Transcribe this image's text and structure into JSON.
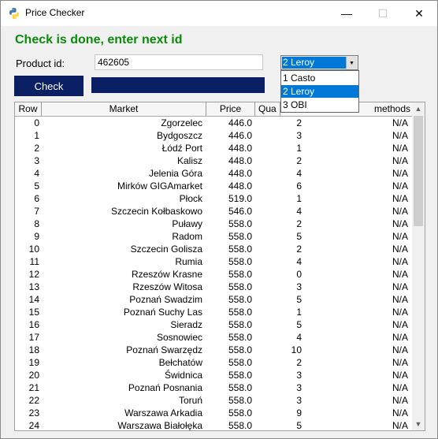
{
  "window": {
    "title": "Price Checker",
    "minimize_glyph": "—",
    "maximize_glyph": "☐",
    "close_glyph": "✕"
  },
  "status_text": "Check is done, enter next id",
  "product": {
    "label": "Product id:",
    "value": "462605"
  },
  "store_select": {
    "selected": "2 Leroy",
    "options": [
      "1 Casto",
      "2 Leroy",
      "3 OBI"
    ],
    "selected_index": 1
  },
  "check_button": "Check",
  "progress": {
    "fraction": 1.0
  },
  "table": {
    "columns": [
      "Row",
      "Market",
      "Price",
      "Quantity",
      "Payment methods"
    ],
    "column_headers_visible": {
      "row": "Row",
      "market": "Market",
      "price": "Price",
      "qty": "Qua",
      "pay": "methods"
    },
    "rows": [
      [
        "0",
        "Zgorzelec",
        "446.0",
        "2",
        "N/A"
      ],
      [
        "1",
        "Bydgoszcz",
        "446.0",
        "3",
        "N/A"
      ],
      [
        "2",
        "Łódź Port",
        "448.0",
        "1",
        "N/A"
      ],
      [
        "3",
        "Kalisz",
        "448.0",
        "2",
        "N/A"
      ],
      [
        "4",
        "Jelenia Góra",
        "448.0",
        "4",
        "N/A"
      ],
      [
        "5",
        "Mirków GIGAmarket",
        "448.0",
        "6",
        "N/A"
      ],
      [
        "6",
        "Płock",
        "519.0",
        "1",
        "N/A"
      ],
      [
        "7",
        "Szczecin Kołbaskowo",
        "546.0",
        "4",
        "N/A"
      ],
      [
        "8",
        "Puławy",
        "558.0",
        "2",
        "N/A"
      ],
      [
        "9",
        "Radom",
        "558.0",
        "5",
        "N/A"
      ],
      [
        "10",
        "Szczecin Golisza",
        "558.0",
        "2",
        "N/A"
      ],
      [
        "11",
        "Rumia",
        "558.0",
        "4",
        "N/A"
      ],
      [
        "12",
        "Rzeszów Krasne",
        "558.0",
        "0",
        "N/A"
      ],
      [
        "13",
        "Rzeszów Witosa",
        "558.0",
        "3",
        "N/A"
      ],
      [
        "14",
        "Poznań Swadzim",
        "558.0",
        "5",
        "N/A"
      ],
      [
        "15",
        "Poznań Suchy Las",
        "558.0",
        "1",
        "N/A"
      ],
      [
        "16",
        "Sieradz",
        "558.0",
        "5",
        "N/A"
      ],
      [
        "17",
        "Sosnowiec",
        "558.0",
        "4",
        "N/A"
      ],
      [
        "18",
        "Poznań Swarzędz",
        "558.0",
        "10",
        "N/A"
      ],
      [
        "19",
        "Bełchatów",
        "558.0",
        "2",
        "N/A"
      ],
      [
        "20",
        "Świdnica",
        "558.0",
        "3",
        "N/A"
      ],
      [
        "21",
        "Poznań Posnania",
        "558.0",
        "3",
        "N/A"
      ],
      [
        "22",
        "Toruń",
        "558.0",
        "3",
        "N/A"
      ],
      [
        "23",
        "Warszawa Arkadia",
        "558.0",
        "9",
        "N/A"
      ],
      [
        "24",
        "Warszawa Białołęka",
        "558.0",
        "5",
        "N/A"
      ]
    ]
  },
  "colors": {
    "status": "#0b8a0b",
    "button": "#0b1f64",
    "selection": "#0078d7"
  },
  "icons": {
    "app": "python-icon",
    "combo": "chevron-down-icon",
    "scroll_up": "scroll-up-icon",
    "scroll_down": "scroll-down-icon"
  }
}
